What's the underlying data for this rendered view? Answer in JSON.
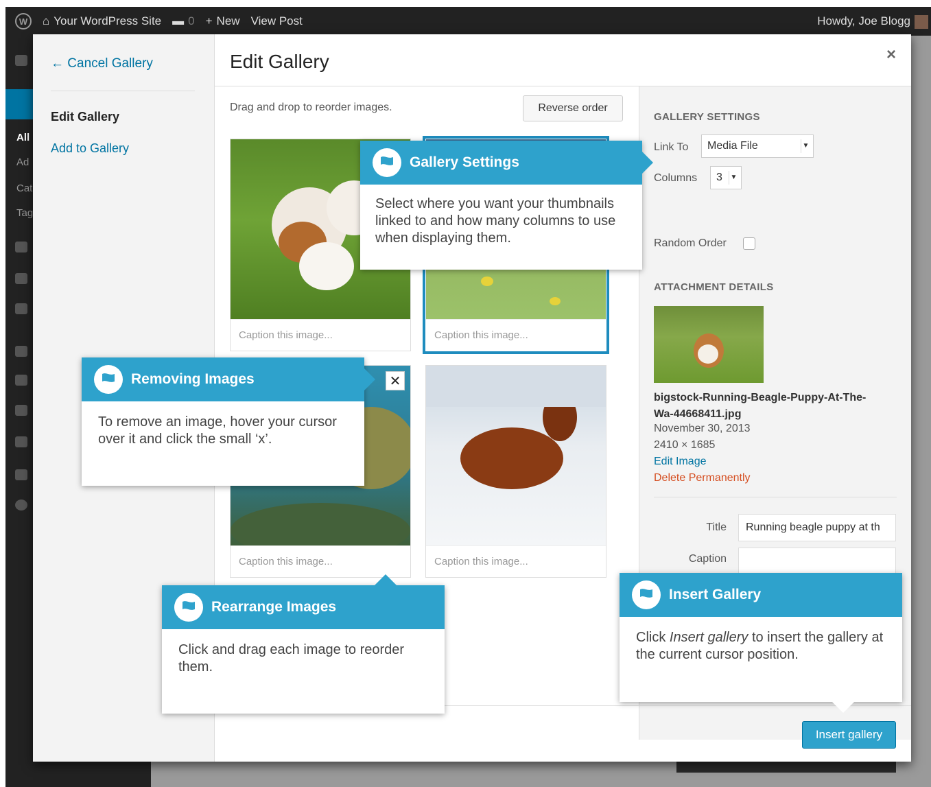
{
  "adminbar": {
    "site_name": "Your WordPress Site",
    "comments_count": "0",
    "new_label": "New",
    "view_post": "View Post",
    "howdy": "Howdy, Joe Blogg"
  },
  "sidemenu": {
    "items": [
      "All",
      "Ad",
      "Cat",
      "Tag"
    ]
  },
  "modal": {
    "cancel_gallery": "← Cancel Gallery",
    "menu_edit_gallery": "Edit Gallery",
    "menu_add_to_gallery": "Add to Gallery",
    "title": "Edit Gallery",
    "close": "×",
    "instructions": "Drag and drop to reorder images.",
    "reverse_order": "Reverse order",
    "tiles": [
      {
        "caption_placeholder": "Caption this image..."
      },
      {
        "caption_placeholder": "Caption this image..."
      },
      {
        "caption_placeholder": "Caption this image..."
      },
      {
        "caption_placeholder": "Caption this image..."
      }
    ],
    "remove_label": "✕",
    "insert_gallery": "Insert gallery"
  },
  "settings": {
    "gallery_heading": "GALLERY SETTINGS",
    "link_to_label": "Link To",
    "link_to_value": "Media File",
    "columns_label": "Columns",
    "columns_value": "3",
    "random_order_label": "Random Order",
    "random_order_checked": false,
    "attachment_heading": "ATTACHMENT DETAILS",
    "file_name": "bigstock-Running-Beagle-Puppy-At-The-Wa-44668411.jpg",
    "date": "November 30, 2013",
    "dimensions": "2410 × 1685",
    "edit_image": "Edit Image",
    "delete_permanently": "Delete Permanently",
    "title_label": "Title",
    "title_value": "Running beagle puppy at th",
    "caption_label": "Caption",
    "caption_value": ""
  },
  "pointers": {
    "gallery_settings": {
      "title": "Gallery Settings",
      "body": "Select where you want  your thumbnails linked to and how many columns to use when displaying them."
    },
    "removing_images": {
      "title": "Removing Images",
      "body": "To remove an image, hover your cursor over it and click the small ‘x’."
    },
    "rearrange_images": {
      "title": "Rearrange Images",
      "body": "Click and drag each image to reorder them."
    },
    "insert_gallery": {
      "title": "Insert Gallery",
      "body_pre": "Click ",
      "body_em": "Insert gallery",
      "body_post": " to insert the gallery at the current cursor position."
    }
  },
  "colors": {
    "accent": "#2ea2cc",
    "link": "#0074a2",
    "danger": "#d54e21",
    "adminbar": "#222222"
  }
}
